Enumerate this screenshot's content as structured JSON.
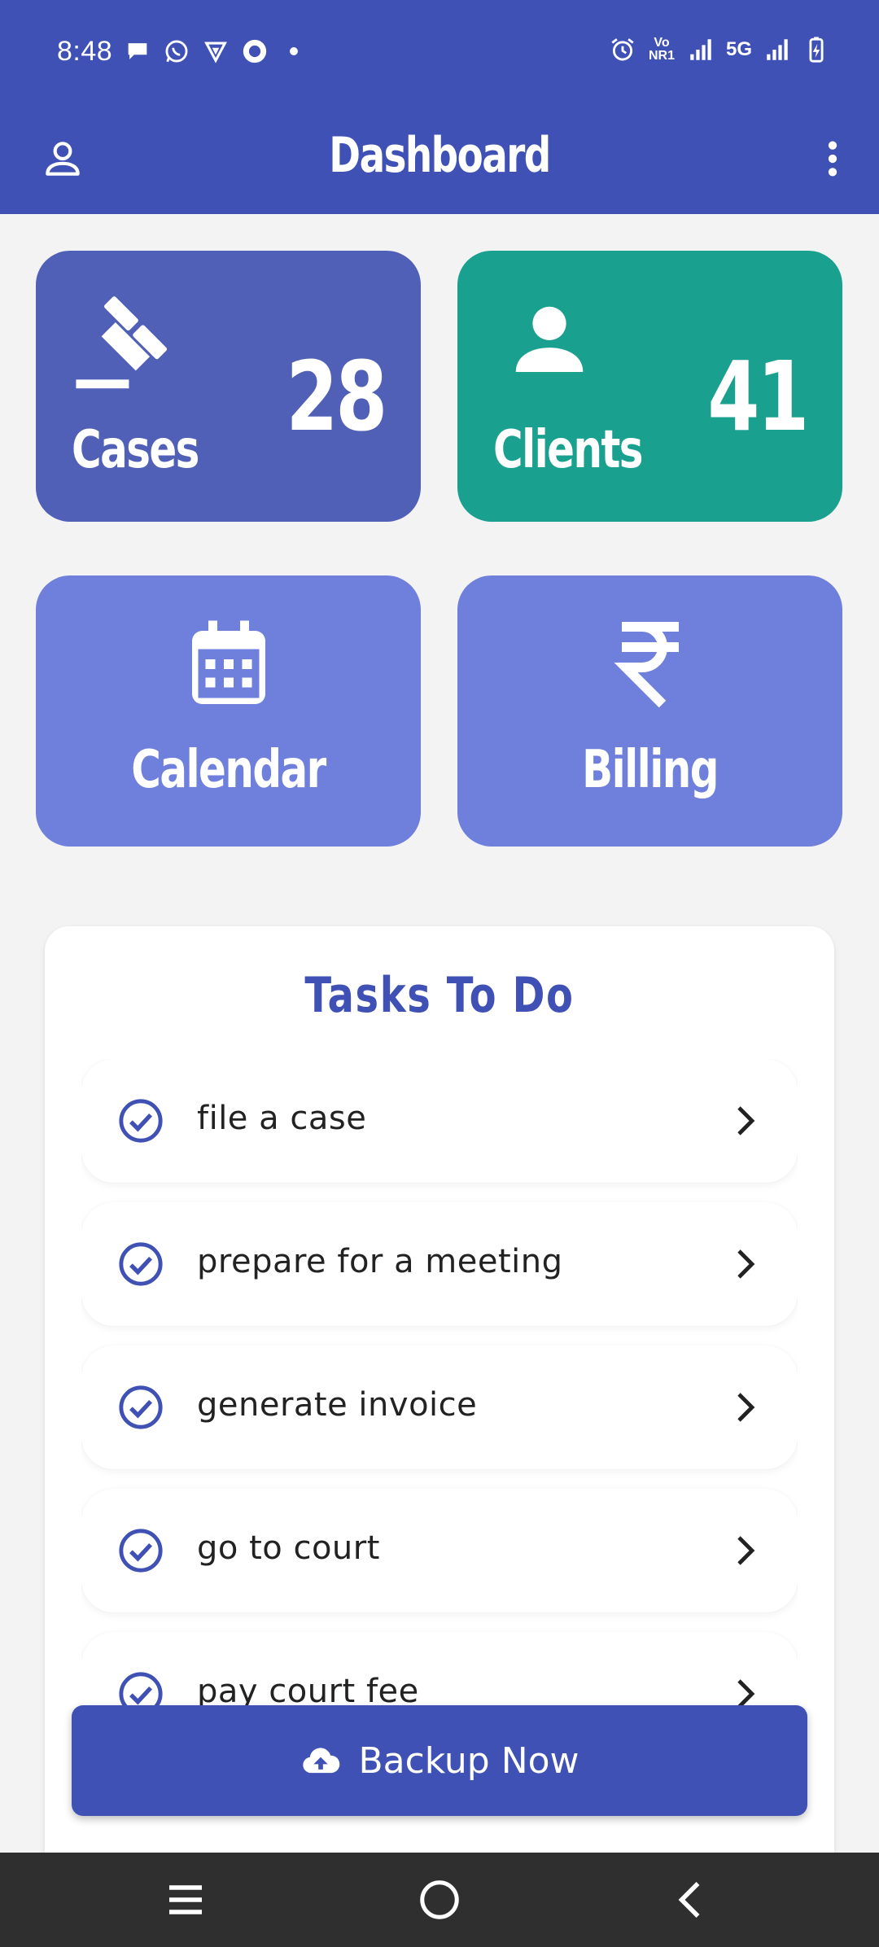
{
  "status_bar": {
    "time": "8:48",
    "left_icons": [
      "chat-bubble-icon",
      "whatsapp-icon",
      "vpn-shield-icon",
      "record-circle-icon",
      "dot-icon"
    ],
    "right_icons": [
      "alarm-icon",
      "volte-icon",
      "signal-icon",
      "signal-icon",
      "battery-charging-icon"
    ],
    "vo_label": "Vo",
    "nr_label": "NR1",
    "network": "5G"
  },
  "app_bar": {
    "title": "Dashboard",
    "profile_icon": "person-outline-icon",
    "menu_icon": "more-vert-icon"
  },
  "tiles": {
    "cases": {
      "label": "Cases",
      "count": "28",
      "icon": "gavel-icon",
      "color": "#5160b7"
    },
    "clients": {
      "label": "Clients",
      "count": "41",
      "icon": "person-icon",
      "color": "#1aa08f"
    },
    "calendar": {
      "label": "Calendar",
      "icon": "calendar-icon",
      "color": "#6f7fdc"
    },
    "billing": {
      "label": "Billing",
      "icon": "rupee-icon",
      "color": "#6f7fdc"
    }
  },
  "tasks": {
    "title": "Tasks To Do",
    "items": [
      {
        "label": "file a case"
      },
      {
        "label": "prepare for a meeting"
      },
      {
        "label": "generate invoice"
      },
      {
        "label": "go to court"
      },
      {
        "label": "pay court fee"
      }
    ]
  },
  "backup": {
    "label": "Backup Now",
    "icon": "cloud-upload-icon"
  },
  "colors": {
    "primary": "#3f51b5",
    "background": "#f3f3f4",
    "nav": "#2f2f2f"
  }
}
